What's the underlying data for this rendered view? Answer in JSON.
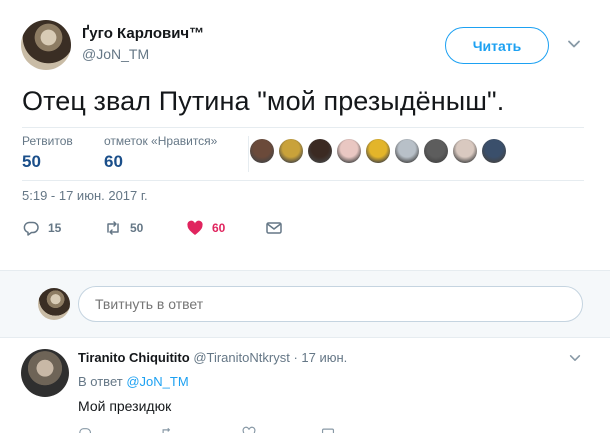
{
  "tweet": {
    "author_name": "Ґуго Карлович™",
    "author_handle": "@JoN_TM",
    "follow_label": "Читать",
    "text": "Отец звал Путина \"мой презыдёныш\".",
    "stats": {
      "retweets_label": "Ретвитов",
      "retweets_value": "50",
      "likes_label": "отметок «Нравится»",
      "likes_value": "60"
    },
    "likers": [
      "#6b4a3a",
      "#c9a23a",
      "#3b2a22",
      "#e9c7c2",
      "#e3b52a",
      "#b8c0c8",
      "#5d5d5d",
      "#d9c9c0",
      "#3a4f6b"
    ],
    "timestamp": "5:19 - 17 июн. 2017 г.",
    "actions": {
      "reply_count": "15",
      "retweet_count": "50",
      "like_count": "60"
    }
  },
  "reply_box": {
    "placeholder": "Твитнуть в ответ"
  },
  "reply": {
    "author_name": "Tiranito Chiquitito",
    "author_handle": "@TiranitoNtkryst",
    "time": "· 17 июн.",
    "in_reply_prefix": "В ответ",
    "in_reply_mention": "@JoN_TM",
    "text": "Мой президюк"
  },
  "colors": {
    "accent": "#1da1f2",
    "like": "#e0245e",
    "stat_value": "#1b4f8a",
    "muted": "#657786"
  }
}
